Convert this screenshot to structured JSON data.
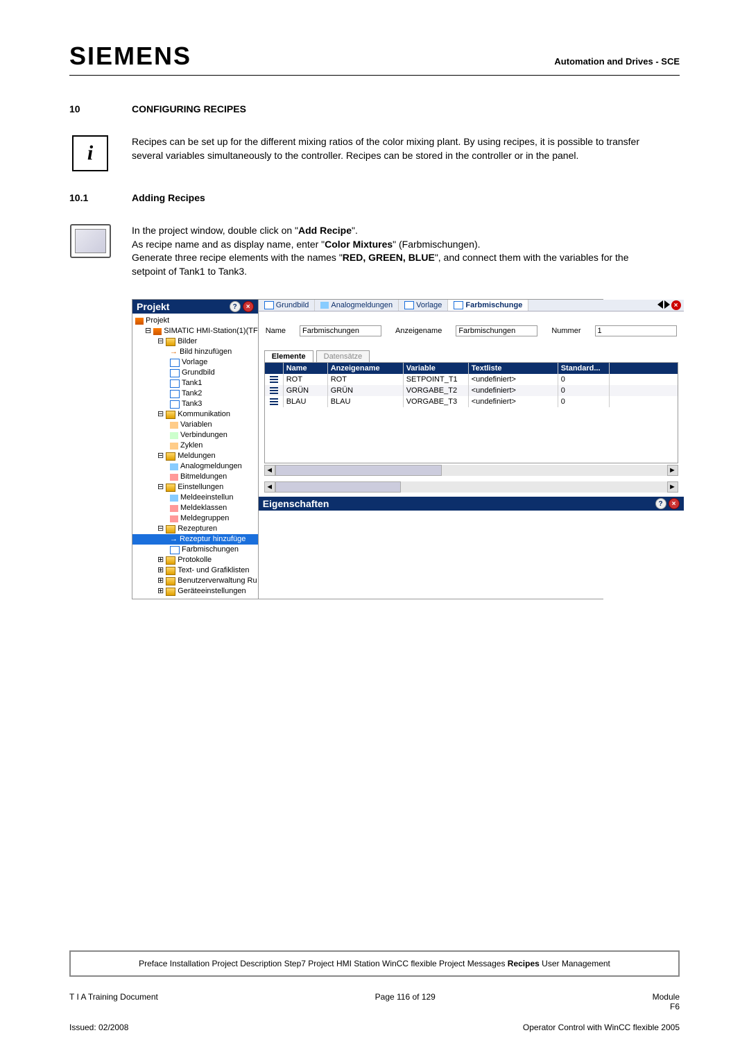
{
  "header": {
    "logo": "SIEMENS",
    "right": "Automation and Drives - SCE"
  },
  "section": {
    "num": "10",
    "title": "CONFIGURING RECIPES"
  },
  "intro_para": "Recipes can be set up for the different mixing ratios of the color mixing plant. By using recipes, it is possible to transfer several variables simultaneously to the controller.  Recipes can be stored in the controller or in the panel.",
  "sub": {
    "num": "10.1",
    "title": "Adding Recipes"
  },
  "body_lines": [
    "In the project window, double click on \"",
    "Add Recipe",
    "\".",
    "As recipe name and as display name, enter \"",
    "Color Mixtures",
    "\" (Farbmischungen).",
    "Generate three recipe elements with the names \"",
    "RED, GREEN, BLUE",
    "\", and connect them with the variables for the setpoint of Tank1 to Tank3."
  ],
  "app": {
    "projekt_title": "Projekt",
    "tree": {
      "root": "Projekt",
      "station": "SIMATIC HMI-Station(1)(TF",
      "bilder": "Bilder",
      "bild_hinzu": "Bild hinzufügen",
      "vorlage": "Vorlage",
      "grundbild": "Grundbild",
      "tank1": "Tank1",
      "tank2": "Tank2",
      "tank3": "Tank3",
      "komm": "Kommunikation",
      "variablen": "Variablen",
      "verbind": "Verbindungen",
      "zyklen": "Zyklen",
      "meldungen": "Meldungen",
      "analog": "Analogmeldungen",
      "bitmeld": "Bitmeldungen",
      "einstell": "Einstellungen",
      "meldeein": "Meldeeinstellun",
      "meldeklass": "Meldeklassen",
      "meldegrupp": "Meldegruppen",
      "rezept": "Rezepturen",
      "rezept_add": "Rezeptur hinzufüge",
      "farb": "Farbmischungen",
      "protok": "Protokolle",
      "textgraf": "Text- und Grafiklisten",
      "benutzer": "Benutzerverwaltung Ru",
      "geraete": "Geräteeinstellungen"
    },
    "tabs": [
      "Grundbild",
      "Analogmeldungen",
      "Vorlage",
      "Farbmischunge"
    ],
    "form": {
      "name_lbl": "Name",
      "name_val": "Farbmischungen",
      "anzeige_lbl": "Anzeigename",
      "anzeige_val": "Farbmischungen",
      "nummer_lbl": "Nummer",
      "nummer_val": "1"
    },
    "subtabs": [
      "Elemente",
      "Datensätze"
    ],
    "grid": {
      "headers": [
        "Name",
        "Anzeigename",
        "Variable",
        "Textliste",
        "Standard..."
      ],
      "rows": [
        {
          "name": "ROT",
          "anz": "ROT",
          "var": "SETPOINT_T1",
          "txt": "<undefiniert>",
          "std": "0"
        },
        {
          "name": "GRÜN",
          "anz": "GRÜN",
          "var": "VORGABE_T2",
          "txt": "<undefiniert>",
          "std": "0"
        },
        {
          "name": "BLAU",
          "anz": "BLAU",
          "var": "VORGABE_T3",
          "txt": "<undefiniert>",
          "std": "0"
        }
      ]
    },
    "props_title": "Eigenschaften"
  },
  "nav": {
    "items": [
      "Preface",
      "Installation",
      "Project Description",
      "Step7 Project",
      "HMI Station",
      "WinCC flexible",
      "Project",
      "Messages",
      "Recipes",
      "User Management"
    ],
    "bold_index": 8
  },
  "footer": {
    "left1": "T I A  Training Document",
    "center1": "Page 116 of 129",
    "right1": "Module",
    "right1b": "F6",
    "left2": "Issued: 02/2008",
    "right2": "Operator Control with WinCC flexible 2005"
  }
}
